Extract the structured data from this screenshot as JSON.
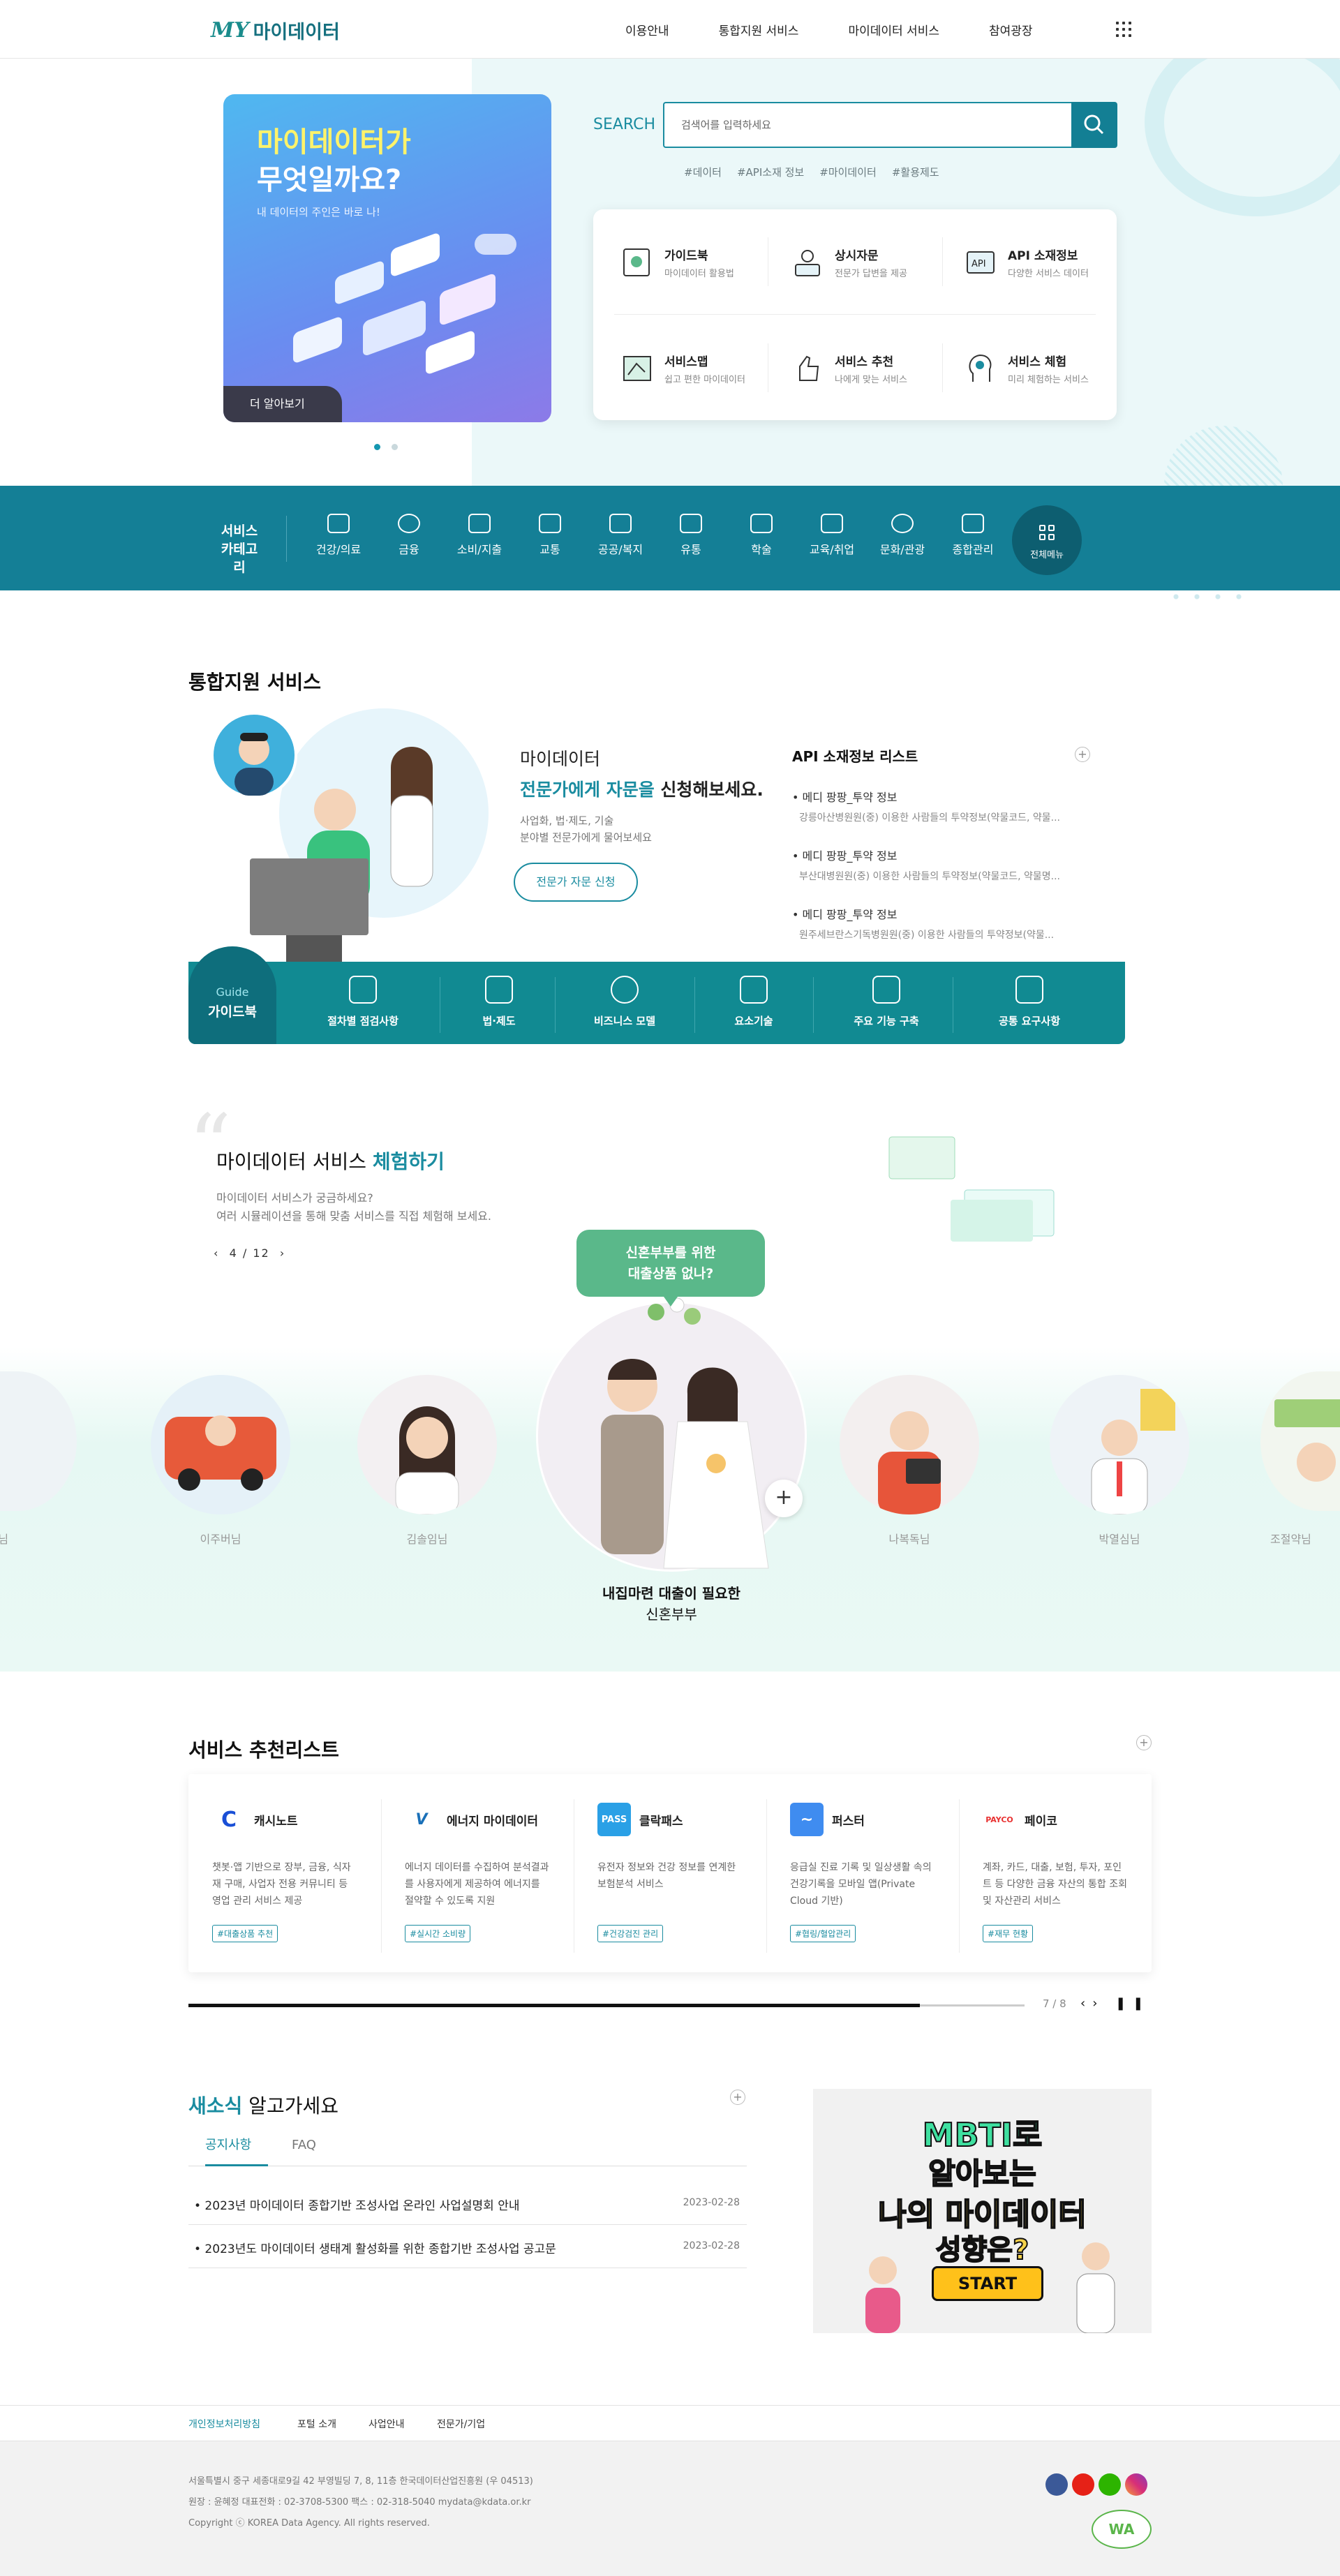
{
  "header": {
    "logo_mark": "MY",
    "logo_text": "마이데이터",
    "nav": [
      "이용안내",
      "통합지원 서비스",
      "마이데이터 서비스",
      "참여광장"
    ]
  },
  "hero": {
    "banner_title_a": "마이데이터가",
    "banner_title_b": "무엇일까요?",
    "banner_sub": "내 데이터의 주인은 바로 나!",
    "banner_more": "더 알아보기",
    "search_label": "SEARCH",
    "search_placeholder": "검색어를 입력하세요",
    "tags": [
      "#데이터",
      "#API소재 정보",
      "#마이데이터",
      "#활용제도"
    ],
    "quick": [
      {
        "name": "가이드북",
        "desc": "마이데이터 활용법"
      },
      {
        "name": "상시자문",
        "desc": "전문가 답변을 제공"
      },
      {
        "name": "API 소재정보",
        "desc": "다양한 서비스 데이터"
      },
      {
        "name": "서비스맵",
        "desc": "쉽고 편한 마이데이터"
      },
      {
        "name": "서비스 추천",
        "desc": "나에게 맞는 서비스"
      },
      {
        "name": "서비스 체험",
        "desc": "미리 체험하는 서비스"
      }
    ],
    "api_icon_text": "API"
  },
  "category": {
    "label_a": "서비스",
    "label_b": "카테고리",
    "items": [
      "건강/의료",
      "금융",
      "소비/지출",
      "교통",
      "공공/복지",
      "유통",
      "학술",
      "교육/취업",
      "문화/관광",
      "종합관리"
    ],
    "all": "전체메뉴"
  },
  "support": {
    "title": "통합지원 서비스",
    "consult_a": "마이데이터",
    "consult_b": "전문가에게 자문을",
    "consult_b2": " 신청해보세요.",
    "consult_c": "사업화, 법·제도, 기술",
    "consult_d": "분야별 전문가에게 물어보세요",
    "consult_btn": "전문가 자문 신청",
    "api_title": "API 소재정보 리스트",
    "api_items": [
      {
        "title": "• 메디 팡팡_투약 정보",
        "sub": "강릉아산병원원(중) 이용한 사람들의 투약정보(약물코드, 약물..."
      },
      {
        "title": "• 메디 팡팡_투약 정보",
        "sub": "부산대병원원(중) 이용한 사람들의 투약정보(약물코드, 약물명..."
      },
      {
        "title": "• 메디 팡팡_투약 정보",
        "sub": "원주세브란스기독병원원(중) 이용한 사람들의 투약정보(약물..."
      }
    ],
    "guide_a": "Guide",
    "guide_b": "가이드북",
    "guide_items": [
      "절차별 점검사항",
      "법·제도",
      "비즈니스 모델",
      "요소기술",
      "주요 기능 구축",
      "공통 요구사항"
    ]
  },
  "experience": {
    "title_a": "마이데이터 서비스",
    "title_b": "체험하기",
    "desc_a": "마이데이터 서비스가 궁금하세요?",
    "desc_b": "여러 시뮬레이션을 통해 맞춤 서비스를 직접 체험해 보세요.",
    "pager": "4 / 12",
    "bubble_a": "신혼부부를 위한",
    "bubble_b": "대출상품 없나?",
    "people": [
      "이혜님",
      "이주버님",
      "김솔임님",
      "나복독님",
      "박열심님",
      "조절약님"
    ],
    "featured_a": "내집마련 대출이 필요한",
    "featured_b": "신혼부부"
  },
  "recommend": {
    "title": "서비스 추천리스트",
    "items": [
      {
        "logo": "C",
        "name": "캐시노트",
        "desc": "챗봇·앱 기반으로 장부, 금융, 식자재 구매, 사업자 전용 커뮤니티 등 영업 관리 서비스 제공",
        "tag": "#대출상품 추천"
      },
      {
        "logo": "V",
        "name": "에너지 마이데이터",
        "desc": "에너지 데이터를 수집하여 분석결과를 사용자에게 제공하여 에너지를 절약할 수 있도록 지원",
        "tag": "#실시간 소비량"
      },
      {
        "logo": "PASS",
        "name": "클락패스",
        "desc": "유전자 정보와 건강 정보를 연계한 보험분석 서비스",
        "tag": "#건강검진 관리"
      },
      {
        "logo": "~",
        "name": "퍼스터",
        "desc": "응급실 진료 기록 및 일상생활 속의 건강기록을 모바일 앱(Private Cloud 기반)",
        "tag": "#협링/혈압관리"
      },
      {
        "logo": "PAYCO",
        "name": "페이코",
        "desc": "계좌, 카드, 대출, 보험, 투자, 포인트 등 다양한 금융 자산의 통합 조회 및 자산관리 서비스",
        "tag": "#재무 현황"
      }
    ],
    "progress": 0.875,
    "counter": "7 / 8"
  },
  "news": {
    "title_a": "새소식",
    "title_b": " 알고가세요",
    "tabs": [
      "공지사항",
      "FAQ"
    ],
    "items": [
      {
        "title": "• 2023년 마이데이터 종합기반 조성사업 온라인 사업설명회 안내",
        "date": "2023-02-28"
      },
      {
        "title": "• 2023년도 마이데이터 생태계 활성화를 위한 종합기반 조성사업 공고문",
        "date": "2023-02-28"
      }
    ],
    "banner_a": "MBTI로",
    "banner_b": "알아보는",
    "banner_c": "나의 마이데이터",
    "banner_d": "성향은?",
    "banner_start": "START"
  },
  "footer": {
    "links": [
      "개인정보처리방침",
      "포털 소개",
      "사업안내",
      "전문가/기업"
    ],
    "address": "서울특별시 중구 세종대로9길 42 부영빌딩 7, 8, 11층 한국데이터산업진흥원 (우 04513)",
    "contact": "원장 : 윤혜정     대표전화 : 02-3708-5300     팩스 : 02-318-5040     mydata@kdata.or.kr",
    "copyright": "Copyright ⓒ KOREA Data Agency. All rights reserved.",
    "wa_mark": "WA"
  },
  "colors": {
    "primary": "#147f96",
    "accent": "#1a8ca0",
    "green": "#5ab88a"
  }
}
